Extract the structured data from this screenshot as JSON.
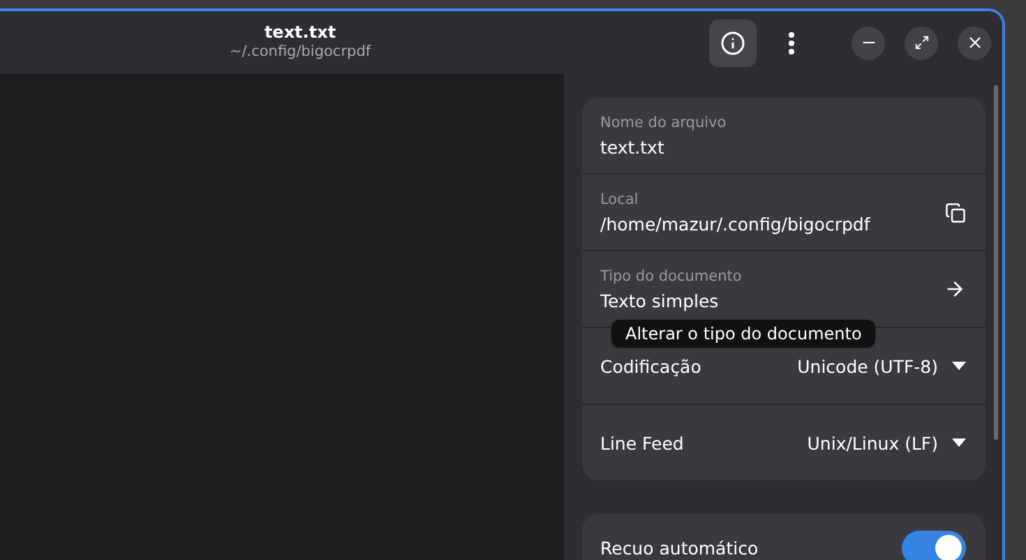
{
  "window": {
    "title": "text.txt",
    "subtitle": "~/.config/bigocrpdf"
  },
  "header_buttons": [
    {
      "kind": "info",
      "selected": true
    },
    {
      "kind": "menu",
      "selected": false
    }
  ],
  "properties": [
    {
      "kind": "field",
      "label": "Nome do arquivo",
      "value": "text.txt"
    },
    {
      "kind": "copy",
      "label": "Local",
      "value": "/home/mazur/.config/bigocrpdf"
    },
    {
      "kind": "link",
      "label": "Tipo do documento",
      "value": "Texto simples"
    },
    {
      "kind": "dropdown",
      "label": "Codificação",
      "value": "Unicode (UTF-8)"
    },
    {
      "kind": "dropdown",
      "label": "Line Feed",
      "value": "Unix/Linux (LF)"
    }
  ],
  "tooltip": "Alterar o tipo do documento",
  "settings": [
    {
      "kind": "switch",
      "label": "Recuo automático",
      "on": true
    }
  ]
}
